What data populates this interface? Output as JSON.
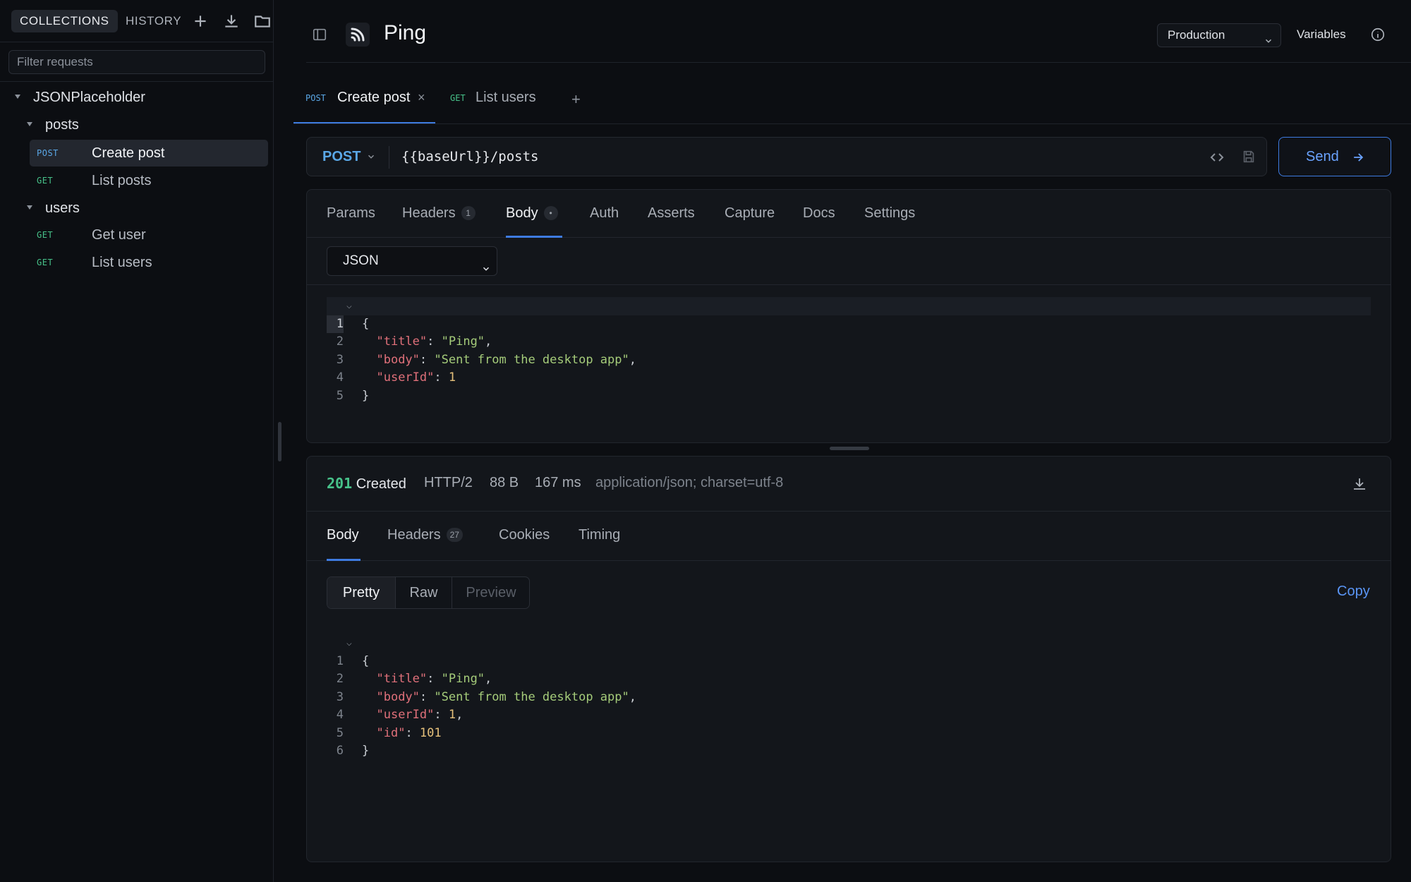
{
  "sidebar": {
    "tabs": [
      "COLLECTIONS",
      "HISTORY"
    ],
    "icons": [
      "plus-icon",
      "download-icon",
      "folder-icon"
    ],
    "filter_placeholder": "Filter requests",
    "collection": "JSONPlaceholder",
    "folders": [
      {
        "name": "posts",
        "requests": [
          {
            "method": "POST",
            "name": "Create post",
            "active": true
          },
          {
            "method": "GET",
            "name": "List posts",
            "active": false
          }
        ]
      },
      {
        "name": "users",
        "requests": [
          {
            "method": "GET",
            "name": "Get user",
            "active": false
          },
          {
            "method": "GET",
            "name": "List users",
            "active": false
          }
        ]
      }
    ]
  },
  "header": {
    "title": "Ping",
    "environment": "Production",
    "variables_label": "Variables"
  },
  "request_tabs": [
    {
      "method": "POST",
      "label": "Create post",
      "active": true,
      "closable": true
    },
    {
      "method": "GET",
      "label": "List users",
      "active": false,
      "closable": false
    }
  ],
  "request": {
    "method": "POST",
    "url": "{{baseUrl}}/posts",
    "send_label": "Send",
    "tabs": [
      {
        "label": "Params"
      },
      {
        "label": "Headers",
        "badge": "1"
      },
      {
        "label": "Body",
        "badge": "•",
        "active": true
      },
      {
        "label": "Auth"
      },
      {
        "label": "Asserts"
      },
      {
        "label": "Capture"
      },
      {
        "label": "Docs"
      },
      {
        "label": "Settings"
      }
    ],
    "body_type": "JSON",
    "body_lines": [
      "{",
      "  \"title\": \"Ping\",",
      "  \"body\": \"Sent from the desktop app\",",
      "  \"userId\": 1",
      "}"
    ]
  },
  "response": {
    "status_code": "201",
    "status_text": "Created",
    "protocol": "HTTP/2",
    "size": "88 B",
    "time": "167 ms",
    "content_type": "application/json; charset=utf-8",
    "tabs": [
      {
        "label": "Body",
        "active": true
      },
      {
        "label": "Headers",
        "badge": "27"
      },
      {
        "label": "Cookies"
      },
      {
        "label": "Timing"
      }
    ],
    "view_modes": [
      "Pretty",
      "Raw",
      "Preview"
    ],
    "active_view": "Pretty",
    "copy_label": "Copy",
    "body_lines": [
      "{",
      "  \"title\": \"Ping\",",
      "  \"body\": \"Sent from the desktop app\",",
      "  \"userId\": 1,",
      "  \"id\": 101",
      "}"
    ]
  },
  "colors": {
    "accent": "#3e7be0",
    "post": "#5aa7e6",
    "get": "#47c28a",
    "status_ok": "#47c28a"
  }
}
